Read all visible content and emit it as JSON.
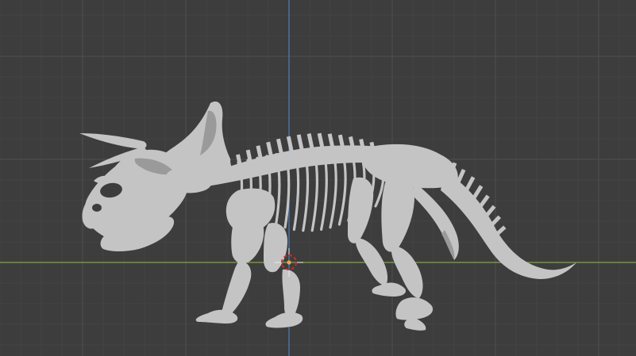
{
  "viewport": {
    "background_color": "#3d3d3d",
    "grid_minor_color": "#444444",
    "grid_major_color": "#505050",
    "x_axis_color": "#7fa83a",
    "z_axis_color": "#4d7fb8",
    "model_color": "#c4c4c4",
    "model_shadow_color": "#9a9a9a",
    "cursor_colors": [
      "#e8e8e8",
      "#d02a2a",
      "#f0a24a"
    ],
    "icons": {
      "cursor": "3d-cursor-icon",
      "origin": "object-origin-icon"
    }
  }
}
